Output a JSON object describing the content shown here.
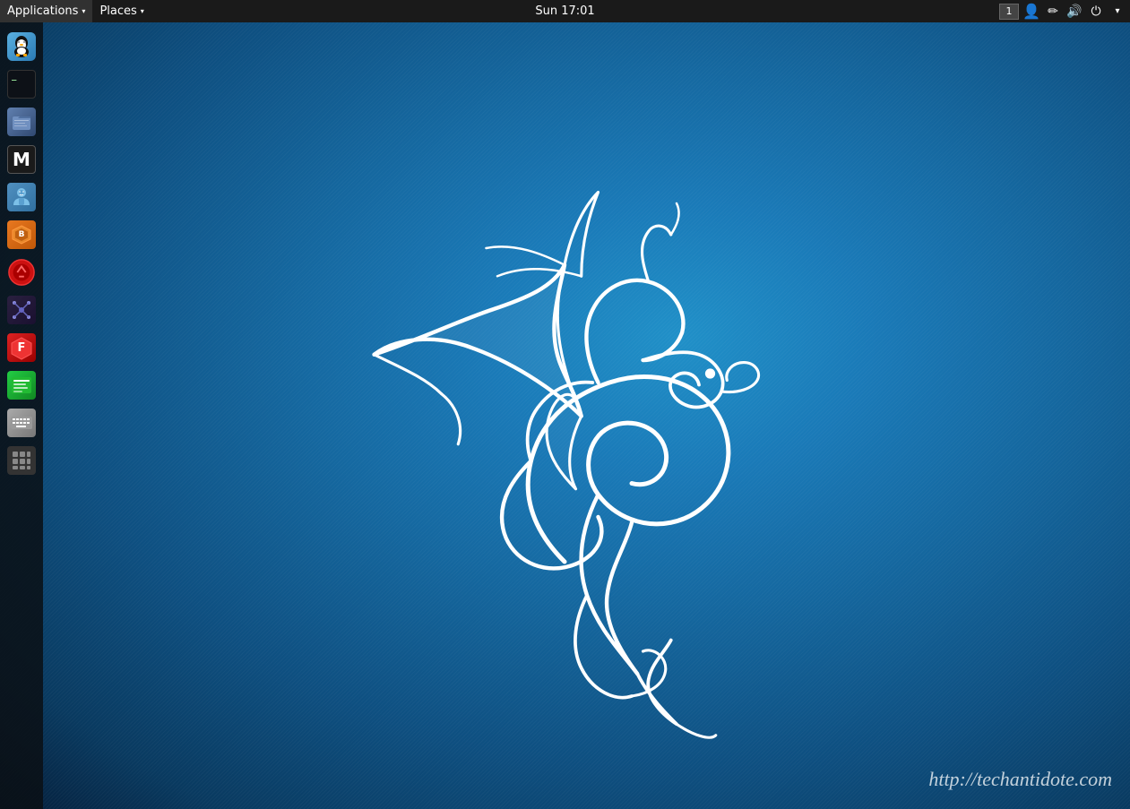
{
  "topbar": {
    "applications_label": "Applications",
    "places_label": "Places",
    "clock": "Sun 17:01",
    "workspace_num": "1"
  },
  "watermark": {
    "text": "http://techantidote.com"
  },
  "dock": {
    "items": [
      {
        "id": "tux",
        "label": "Tux/Iceweasel",
        "icon_type": "tux"
      },
      {
        "id": "terminal",
        "label": "Terminal",
        "icon_type": "terminal"
      },
      {
        "id": "files",
        "label": "Files",
        "icon_type": "files"
      },
      {
        "id": "metasploit",
        "label": "Metasploit",
        "icon_type": "meta"
      },
      {
        "id": "person",
        "label": "Person",
        "icon_type": "person"
      },
      {
        "id": "burpsuite",
        "label": "BurpSuite",
        "icon_type": "burpsuite"
      },
      {
        "id": "redapp",
        "label": "Red App",
        "icon_type": "red"
      },
      {
        "id": "maltego",
        "label": "Maltego",
        "icon_type": "maltego"
      },
      {
        "id": "fern",
        "label": "Fern WiFi Cracker",
        "icon_type": "fern"
      },
      {
        "id": "greenapp",
        "label": "Green App",
        "icon_type": "green"
      },
      {
        "id": "keyboard",
        "label": "Keyboard",
        "icon_type": "keyboard"
      },
      {
        "id": "grid",
        "label": "Show Apps",
        "icon_type": "grid"
      }
    ]
  }
}
